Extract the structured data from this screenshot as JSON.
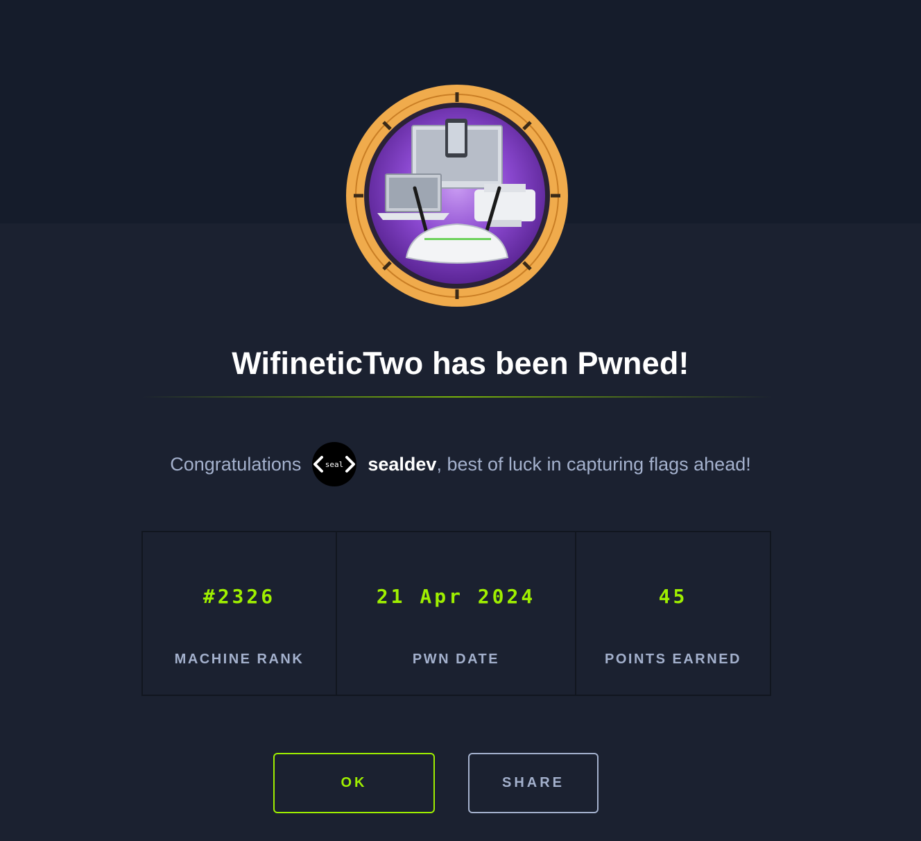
{
  "colors": {
    "background": "#1b2130",
    "header_band": "#151c2b",
    "accent_green": "#9fef00",
    "muted_text": "#a4b1cd",
    "badge_ring": "#f0ab4c",
    "badge_inner": "#7d3fbf"
  },
  "badge": {
    "icon": "wifinetic-two-machine-badge"
  },
  "title": "WifineticTwo has been Pwned!",
  "congrats": {
    "prefix": "Congratulations",
    "avatar_icon": "seal-avatar-icon",
    "avatar_text": "seal",
    "username": "sealdev",
    "suffix": ", best of luck in capturing flags ahead!"
  },
  "stats": [
    {
      "value": "#2326",
      "label": "MACHINE RANK"
    },
    {
      "value": "21 Apr 2024",
      "label": "PWN DATE"
    },
    {
      "value": "45",
      "label": "POINTS EARNED"
    }
  ],
  "buttons": {
    "ok": "OK",
    "share": "SHARE"
  }
}
